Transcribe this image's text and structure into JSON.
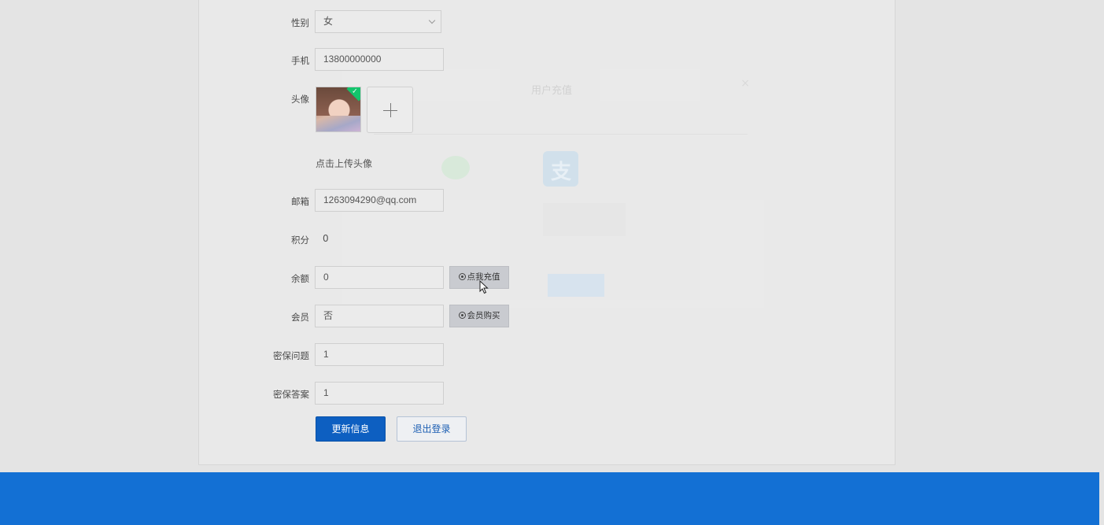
{
  "form": {
    "gender": {
      "label": "性别",
      "value": "女"
    },
    "phone": {
      "label": "手机",
      "value": "13800000000"
    },
    "avatar": {
      "label": "头像",
      "upload_hint": "点击上传头像"
    },
    "email": {
      "label": "邮箱",
      "value": "1263094290@qq.com"
    },
    "points": {
      "label": "积分",
      "value": "0"
    },
    "balance": {
      "label": "余额",
      "value": "0",
      "action_label": "点我充值"
    },
    "member": {
      "label": "会员",
      "value": "否",
      "action_label": "会员购买"
    },
    "security_question": {
      "label": "密保问题",
      "value": "1"
    },
    "security_answer": {
      "label": "密保答案",
      "value": "1"
    },
    "update_button": "更新信息",
    "logout_button": "退出登录"
  },
  "background_dialog": {
    "title": "用户充值"
  },
  "colors": {
    "primary": "#0d5fc1",
    "footer": "#1370d4",
    "success": "#13c46c"
  }
}
